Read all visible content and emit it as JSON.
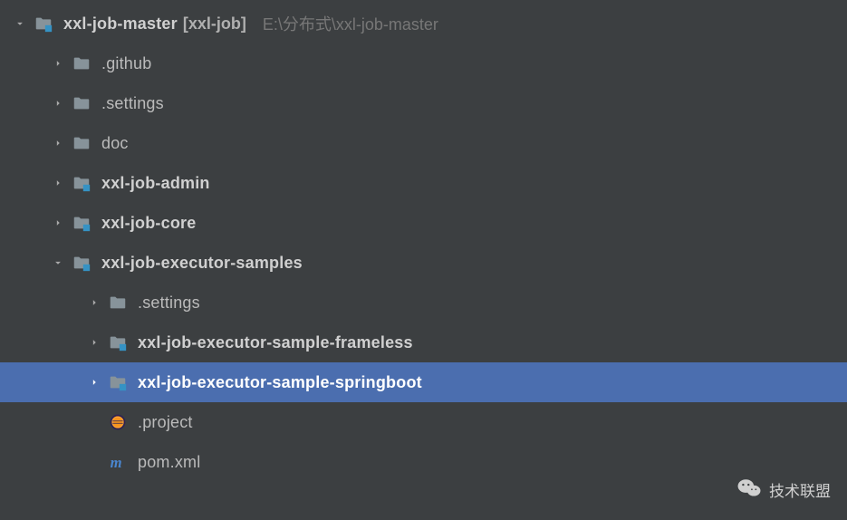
{
  "root": {
    "name": "xxl-job-master",
    "bracket": "[xxl-job]",
    "path": "E:\\分布式\\xxl-job-master"
  },
  "nodes": [
    {
      "label": ".github",
      "bold": false,
      "icon": "folder",
      "indent": 1,
      "arrow": "right"
    },
    {
      "label": ".settings",
      "bold": false,
      "icon": "folder",
      "indent": 1,
      "arrow": "right"
    },
    {
      "label": "doc",
      "bold": false,
      "icon": "folder",
      "indent": 1,
      "arrow": "right"
    },
    {
      "label": "xxl-job-admin",
      "bold": true,
      "icon": "module",
      "indent": 1,
      "arrow": "right"
    },
    {
      "label": "xxl-job-core",
      "bold": true,
      "icon": "module",
      "indent": 1,
      "arrow": "right"
    },
    {
      "label": "xxl-job-executor-samples",
      "bold": true,
      "icon": "module",
      "indent": 1,
      "arrow": "down"
    },
    {
      "label": ".settings",
      "bold": false,
      "icon": "folder",
      "indent": 2,
      "arrow": "right"
    },
    {
      "label": "xxl-job-executor-sample-frameless",
      "bold": true,
      "icon": "module",
      "indent": 2,
      "arrow": "right"
    },
    {
      "label": "xxl-job-executor-sample-springboot",
      "bold": true,
      "icon": "module",
      "indent": 2,
      "arrow": "right",
      "selected": true
    },
    {
      "label": ".project",
      "bold": false,
      "icon": "eclipse",
      "indent": 2,
      "arrow": "none"
    },
    {
      "label": "pom.xml",
      "bold": false,
      "icon": "maven",
      "indent": 2,
      "arrow": "none"
    }
  ],
  "watermark": "技术联盟"
}
